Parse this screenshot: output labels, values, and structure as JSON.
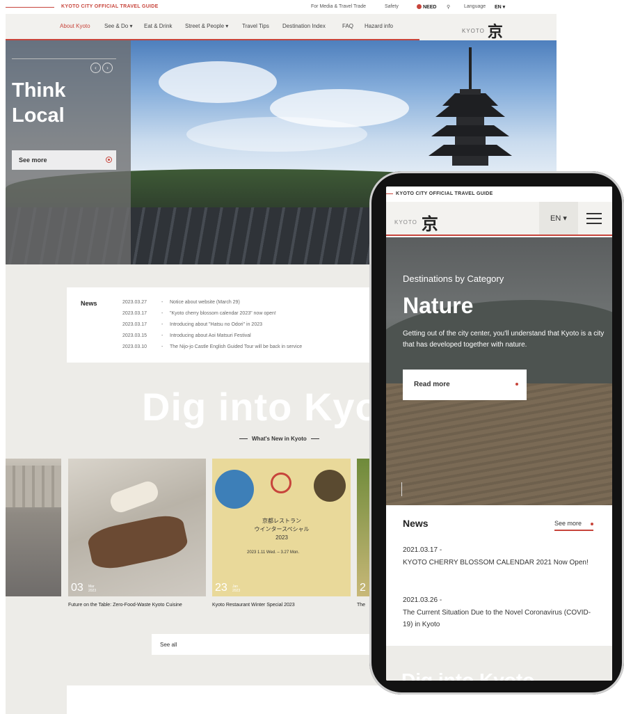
{
  "desktop": {
    "topbar": {
      "brand": "KYOTO CITY OFFICIAL TRAVEL GUIDE",
      "media": "For Media & Travel Trade",
      "safety": "Safety",
      "need": "NEED",
      "language_label": "Language",
      "language_value": "EN"
    },
    "nav": [
      {
        "label": "About Kyoto",
        "active": true
      },
      {
        "label": "See & Do ▾"
      },
      {
        "label": "Eat & Drink"
      },
      {
        "label": "Street & People ▾"
      },
      {
        "label": "Travel Tips"
      },
      {
        "label": "Destination Index"
      },
      {
        "label": "FAQ"
      },
      {
        "label": "Hazard info"
      }
    ],
    "logo": {
      "text": "KYOTO",
      "kanji": "京"
    },
    "hero": {
      "title_line1": "Think",
      "title_line2": "Local",
      "button": "See more"
    },
    "news": {
      "label": "News",
      "items": [
        {
          "date": "2023.03.27",
          "text": "Notice about website (March 29)"
        },
        {
          "date": "2023.03.17",
          "text": "\"Kyoto cherry blossom calendar 2023\" now open!"
        },
        {
          "date": "2023.03.17",
          "text": "Introducing about \"Hatsu no Odori\" in 2023"
        },
        {
          "date": "2023.03.15",
          "text": "Introducing about Aoi Matsuri Festival"
        },
        {
          "date": "2023.03.10",
          "text": "The Nijo-jo Castle English Guided Tour will be back in service"
        }
      ]
    },
    "dig_title": "Dig into Kyoto",
    "whats_new": "What's New in Kyoto",
    "cards": [
      {
        "num": "",
        "month": "",
        "caption": ""
      },
      {
        "num": "03",
        "month": "Mar",
        "year": "2023",
        "caption": "Future on the Table: Zero-Food-Waste Kyoto Cuisine"
      },
      {
        "num": "23",
        "month": "Jan",
        "year": "2023",
        "caption": "Kyoto Restaurant Winter Special 2023"
      },
      {
        "num": "2",
        "month": "",
        "caption": "The"
      },
      {
        "poster_line1": "京都レストラン",
        "poster_line2": "ウインタースペシャル",
        "poster_year": "2023",
        "poster_dates": "2023 1.11 Wed. – 3.27 Mon."
      }
    ],
    "see_all": "See all"
  },
  "phone": {
    "brand": "KYOTO CITY OFFICIAL TRAVEL GUIDE",
    "logo": {
      "text": "KYOTO",
      "kanji": "京"
    },
    "lang": "EN ▾",
    "hero": {
      "subtitle": "Destinations by Category",
      "title": "Nature",
      "desc": "Getting out of the city center, you'll understand that Kyoto is a city that has developed together with nature.",
      "button": "Read more"
    },
    "news": {
      "title": "News",
      "see_more": "See more",
      "items": [
        {
          "date": "2021.03.17  -",
          "text": "KYOTO CHERRY BLOSSOM CALENDAR 2021 Now Open!"
        },
        {
          "date": "2021.03.26  -",
          "text": "The Current Situation Due to the Novel Coronavirus (COVID-19) in Kyoto"
        }
      ]
    },
    "ghost": "Dig into Kyoto"
  },
  "colors": {
    "accent": "#c7443b",
    "bg": "#edece8"
  }
}
